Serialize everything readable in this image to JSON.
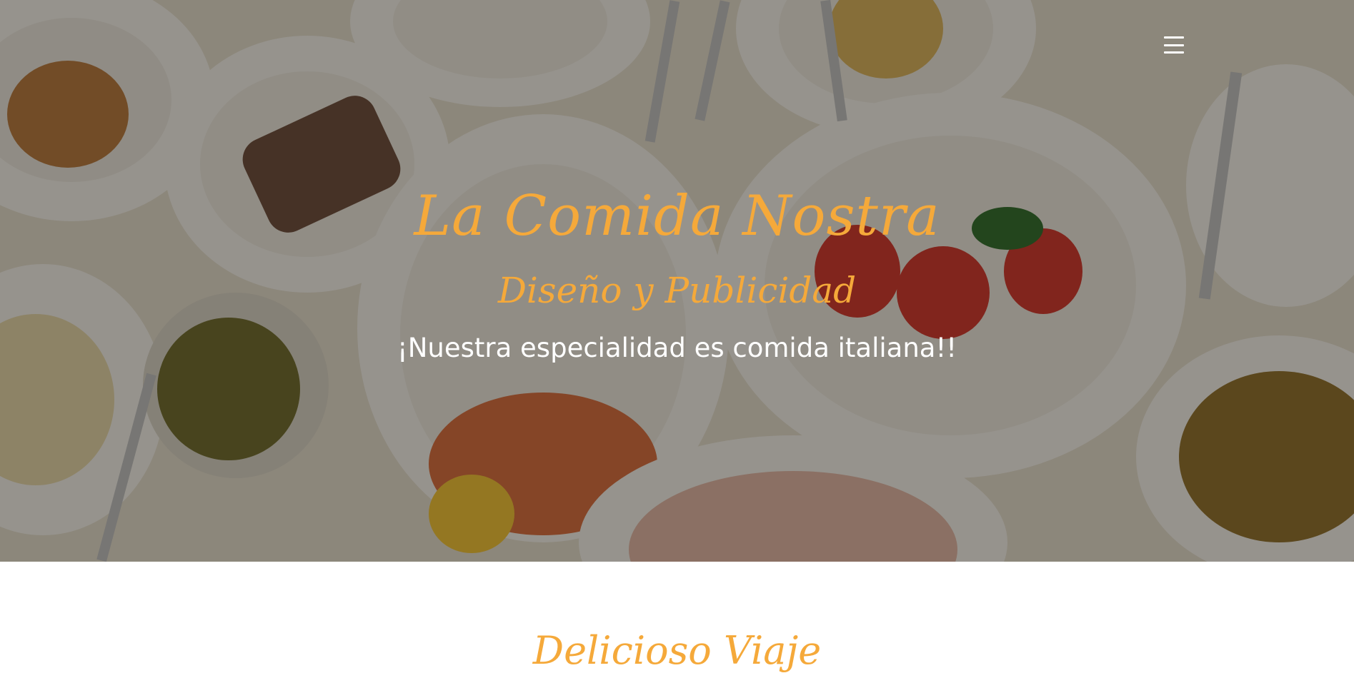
{
  "hero": {
    "title": "La Comida Nostra",
    "subtitle": "Diseño y Publicidad",
    "tagline": "¡Nuestra especialidad es comida italiana!!",
    "background_image": "table with plates of italian food"
  },
  "nav": {
    "menu_icon": "hamburger-menu-icon"
  },
  "section": {
    "title": "Delicioso Viaje"
  },
  "colors": {
    "accent": "#f5a93a",
    "text_light": "#ffffff",
    "page_bg": "#ffffff"
  }
}
